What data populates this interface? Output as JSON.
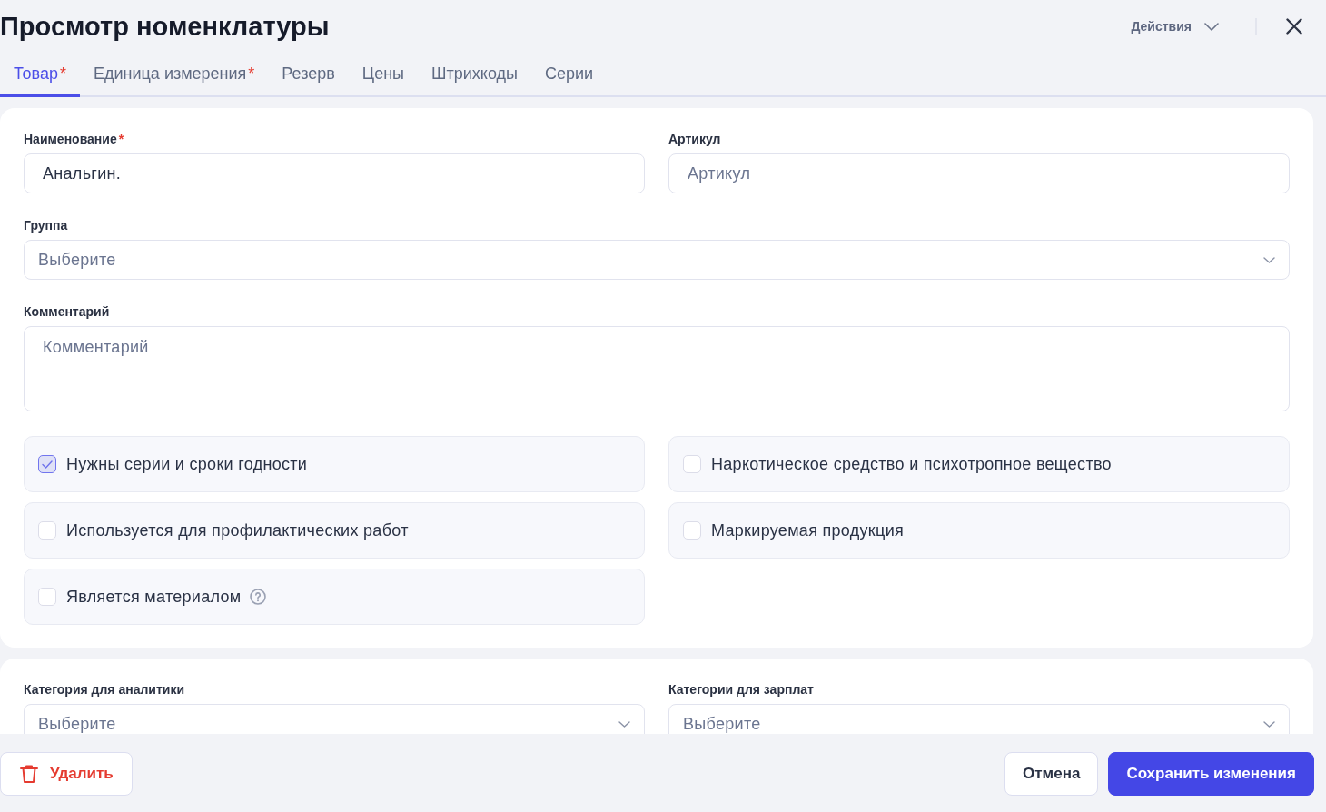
{
  "header": {
    "title": "Просмотр номенклатуры",
    "actions_label": "Действия"
  },
  "tabs": [
    {
      "label": "Товар",
      "marker": "*",
      "selected": true
    },
    {
      "label": "Единица измерения",
      "marker": "*",
      "selected": false
    },
    {
      "label": "Резерв",
      "selected": false
    },
    {
      "label": "Цены",
      "selected": false
    },
    {
      "label": "Штрихкоды",
      "selected": false
    },
    {
      "label": "Серии",
      "selected": false
    }
  ],
  "main_section": {
    "field_rows": [
      [
        {
          "kind": "input",
          "label": "Наименование",
          "marker": "*",
          "value": "Анальгин."
        },
        {
          "kind": "input",
          "label": "Артикул",
          "placeholder": "Артикул"
        }
      ],
      [
        {
          "kind": "select",
          "label": "Группа",
          "placeholder": "Выберите"
        }
      ],
      [
        {
          "kind": "textarea",
          "label": "Комментарий",
          "placeholder": "Комментарий"
        }
      ]
    ],
    "options": [
      {
        "label": "Нужны серии и сроки годности",
        "checked": true,
        "help": false
      },
      {
        "label": "Наркотическое средство и психотропное вещество",
        "checked": false,
        "help": false
      },
      {
        "label": "Используется для профилактических работ",
        "checked": false,
        "help": false
      },
      {
        "label": "Маркируемая продукция",
        "checked": false,
        "help": false
      },
      {
        "label": "Является материалом",
        "checked": false,
        "help": true
      }
    ]
  },
  "categories_section": {
    "field_rows": [
      [
        {
          "kind": "select",
          "label": "Категория для аналитики",
          "placeholder": "Выберите"
        },
        {
          "kind": "select",
          "label": "Категории для зарплат",
          "placeholder": "Выберите"
        }
      ]
    ]
  },
  "footer": {
    "buttons": [
      {
        "kind": "danger",
        "label": "Удалить"
      },
      {
        "kind": "secondary",
        "label": "Отмена"
      },
      {
        "kind": "primary",
        "label": "Сохранить изменения"
      }
    ]
  }
}
